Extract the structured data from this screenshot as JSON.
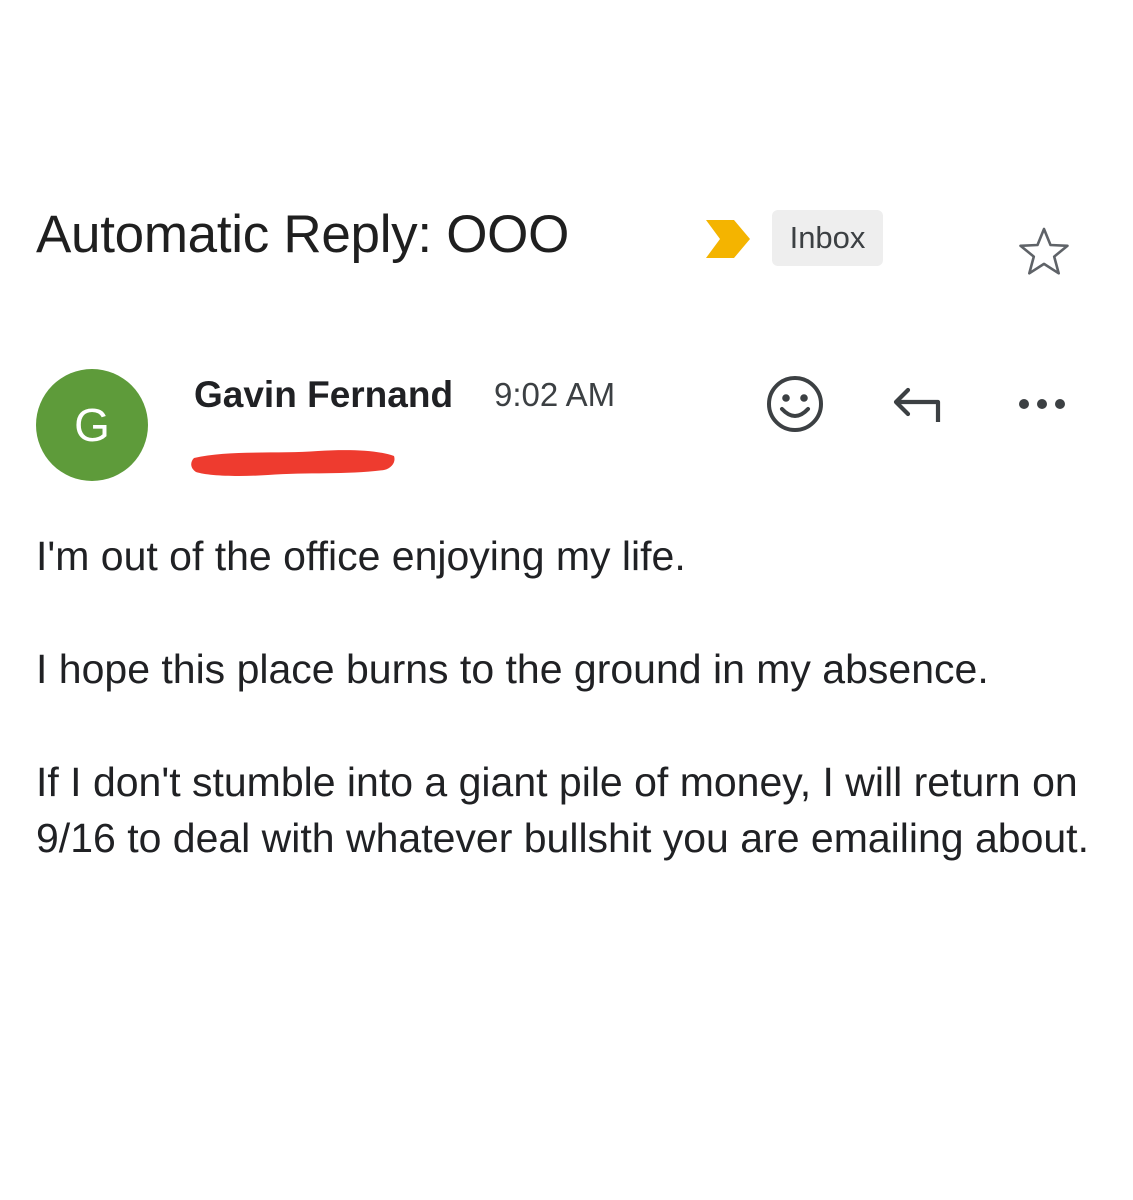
{
  "message": {
    "subject": "Automatic Reply: OOO",
    "label": "Inbox",
    "importance_marker_color": "#f4b400",
    "starred": false
  },
  "sender": {
    "avatar_letter": "G",
    "avatar_color": "#5e9b3a",
    "name": "Gavin Fernand",
    "time": "9:02 AM",
    "recipient_redacted": true,
    "redaction_color": "#ee3b2f"
  },
  "actions": {
    "emoji_icon": "smiley-face-icon",
    "reply_icon": "reply-arrow-icon",
    "more_icon": "more-options-icon",
    "star_icon": "star-outline-icon"
  },
  "body": {
    "paragraphs": [
      "I'm out of the office enjoying my life.",
      "I hope this place burns to the ground in my absence.",
      "If I don't stumble into a giant pile of money, I will return on 9/16 to deal with whatever bullshit you are emailing about."
    ]
  }
}
